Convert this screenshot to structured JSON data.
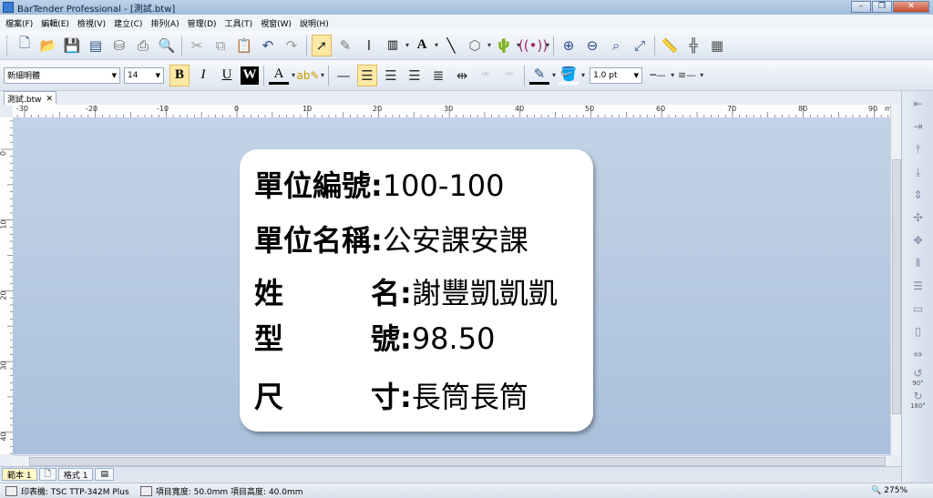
{
  "window": {
    "title": "BarTender Professional - [測試.btw]"
  },
  "menu": [
    "檔案(F)",
    "編輯(E)",
    "檢視(V)",
    "建立(C)",
    "排列(A)",
    "管理(D)",
    "工具(T)",
    "視窗(W)",
    "說明(H)"
  ],
  "format": {
    "font": "新細明體",
    "size": "14",
    "line_width": "1.0 pt"
  },
  "doc_tab": {
    "name": "測試.btw",
    "close": "✕"
  },
  "ruler": {
    "unit": "mm",
    "h_labels": [
      "-30",
      "-20",
      "-10",
      "0",
      "10",
      "20",
      "30",
      "40",
      "50",
      "60",
      "70",
      "80",
      "90"
    ],
    "v_labels": [
      "0",
      "10",
      "20",
      "30",
      "40"
    ]
  },
  "label": {
    "rows": [
      {
        "key": "單位編號:",
        "value": "100-100"
      },
      {
        "key": "單位名稱:",
        "value": "公安課安課"
      },
      {
        "key": "姓　　　名:",
        "value": "謝豐凱凱凱"
      },
      {
        "key": "型　　　號:",
        "value": "98.50"
      },
      {
        "key": "尺　　　寸:",
        "value": "長筒長筒"
      }
    ]
  },
  "rotate": {
    "r90": "90°",
    "r180": "180°"
  },
  "bottom_tabs": [
    "範本 1",
    "格式 1"
  ],
  "status": {
    "printer": "印表機: TSC TTP-342M Plus",
    "width": "項目寬度: 50.0mm",
    "height": "項目高度: 40.0mm",
    "zoom": "275%"
  },
  "colors": {
    "canvas_top": "#c3d3e6",
    "canvas_bottom": "#a9c0dc",
    "highlight": "#fde9a6"
  }
}
